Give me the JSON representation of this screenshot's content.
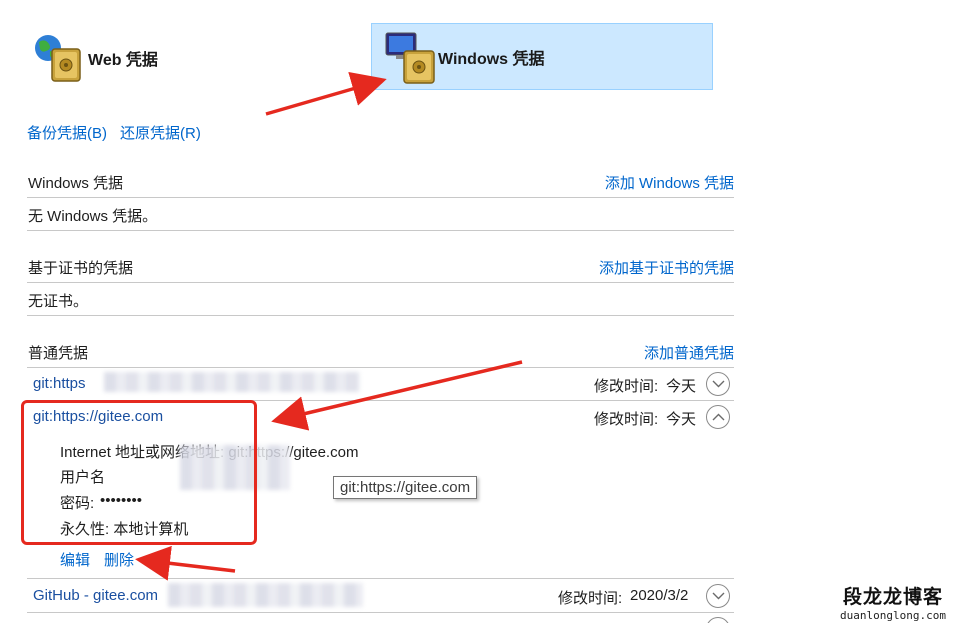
{
  "tiles": {
    "web_label": "Web 凭据",
    "windows_label": "Windows 凭据"
  },
  "actions": {
    "backup": "备份凭据(B)",
    "restore": "还原凭据(R)"
  },
  "sections": {
    "windows": {
      "title": "Windows 凭据",
      "add_link": "添加 Windows 凭据",
      "empty": "无 Windows 凭据。"
    },
    "certificate": {
      "title": "基于证书的凭据",
      "add_link": "添加基于证书的凭据",
      "empty": "无证书。"
    },
    "generic": {
      "title": "普通凭据",
      "add_link": "添加普通凭据"
    }
  },
  "credentials": [
    {
      "name": "git:https",
      "modified_label": "修改时间:",
      "modified_value": "今天"
    },
    {
      "name": "git:https://gitee.com",
      "modified_label": "修改时间:",
      "modified_value": "今天",
      "details": {
        "address": "Internet 地址或网络地址: git:https://gitee.com",
        "username_label": "用户名",
        "password_label": "密码:",
        "password_value": "••••••••",
        "persistence": "永久性: 本地计算机"
      },
      "edit_label": "编辑",
      "delete_label": "删除"
    },
    {
      "name": "GitHub - gitee.com",
      "modified_label": "修改时间:",
      "modified_value": "2020/3/2"
    }
  ],
  "tooltip": "git:https://gitee.com",
  "watermark": {
    "line1": "段龙龙博客",
    "line2": "duanlonglong.com"
  },
  "colors": {
    "link": "#0066cc",
    "selected_tile": "#cce8ff",
    "annotation_red": "#e5291f"
  }
}
